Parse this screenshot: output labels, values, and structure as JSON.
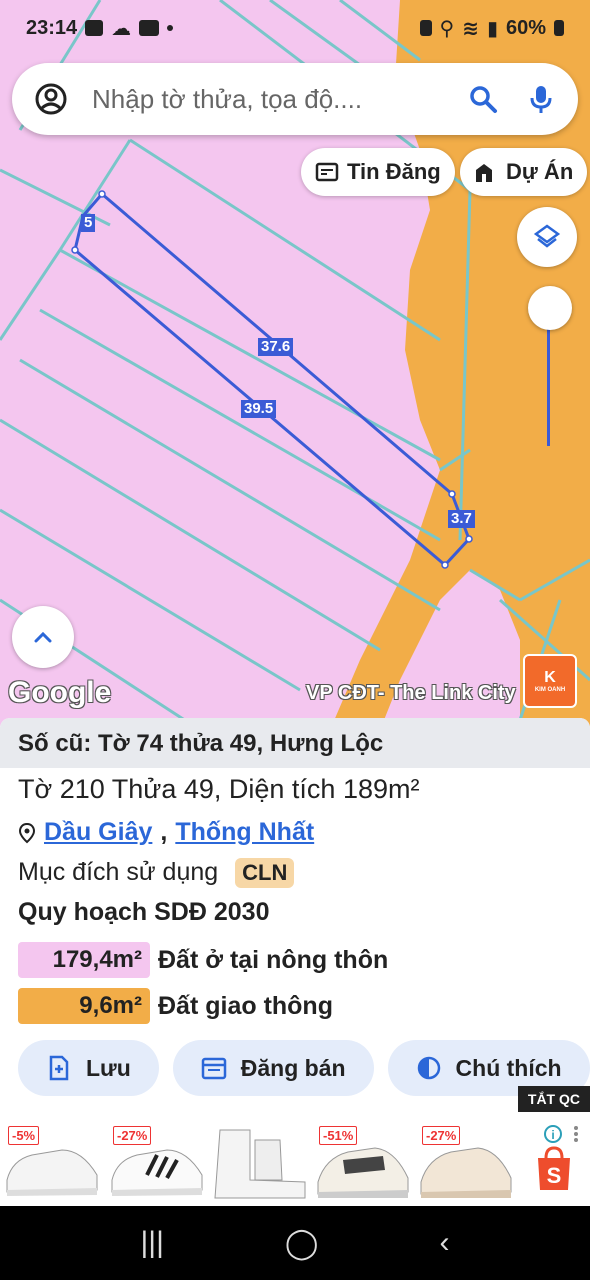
{
  "status": {
    "time": "23:14",
    "battery": "60%"
  },
  "search": {
    "placeholder": "Nhập tờ thửa, tọa độ...."
  },
  "chips": {
    "listing": "Tin Đăng",
    "project": "Dự Án"
  },
  "map": {
    "edge_labels": [
      "5",
      "37.6",
      "39.5",
      "3.7"
    ],
    "logo": "Google",
    "attribution": "VP CĐT- The Link City",
    "badge": "K",
    "badge_sub": "KIM OANH"
  },
  "parcel": {
    "old_ref": "Số cũ: Tờ 74 thửa 49, Hưng Lộc",
    "summary": "Tờ 210 Thửa 49, Diện tích 189m²",
    "district": "Dầu Giây",
    "city": "Thống Nhất",
    "usage_label": "Mục đích sử dụng",
    "usage_code": "CLN",
    "plan_title": "Quy hoạch SDĐ 2030",
    "zones": [
      {
        "area": "179,4m²",
        "label": "Đất ở tại nông thôn",
        "color": "#f4c6ef"
      },
      {
        "area": "9,6m²",
        "label": "Đất giao thông",
        "color": "#f2ad48"
      }
    ]
  },
  "actions": [
    {
      "label": "Lưu",
      "icon": "add-file-icon"
    },
    {
      "label": "Đăng bán",
      "icon": "calendar-icon"
    },
    {
      "label": "Chú thích",
      "icon": "contrast-icon"
    }
  ],
  "ads": {
    "close_label": "TẮT QC",
    "discounts": [
      "-5%",
      "-27%",
      "",
      "-51%",
      "-27%"
    ]
  },
  "colors": {
    "residential": "#f4c6ef",
    "transport": "#f2ad48",
    "boundary": "#3b5bd6",
    "cadastral": "#79c6c9"
  }
}
